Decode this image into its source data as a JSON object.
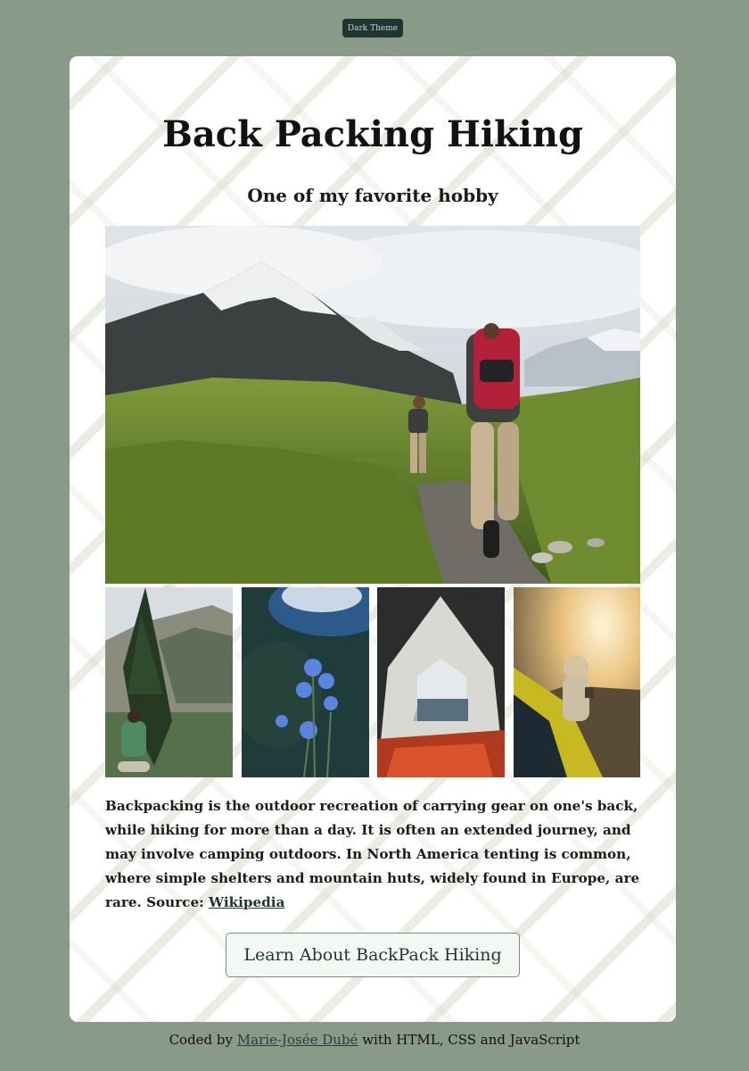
{
  "theme_button": {
    "label": "Dark Theme"
  },
  "card": {
    "title": "Back Packing Hiking",
    "subtitle": "One of my favorite hobby"
  },
  "description": {
    "text": "Backpacking is the outdoor recreation of carrying gear on one's back, while hiking for more than a day. It is often an extended journey, and may involve camping outdoors. In North America tenting is common, where simple shelters and mountain huts, widely found in Europe, are rare. Source:",
    "link_label": "Wikipedia"
  },
  "learn_button": {
    "label": "Learn About BackPack Hiking"
  },
  "footer": {
    "prefix": "Coded by",
    "author": "Marie-Josée Dubé",
    "suffix": "with HTML, CSS and JavaScript"
  },
  "colors": {
    "page_background": "#8a9a88",
    "card_background": "#ffffff",
    "accent": "#1f3532"
  }
}
